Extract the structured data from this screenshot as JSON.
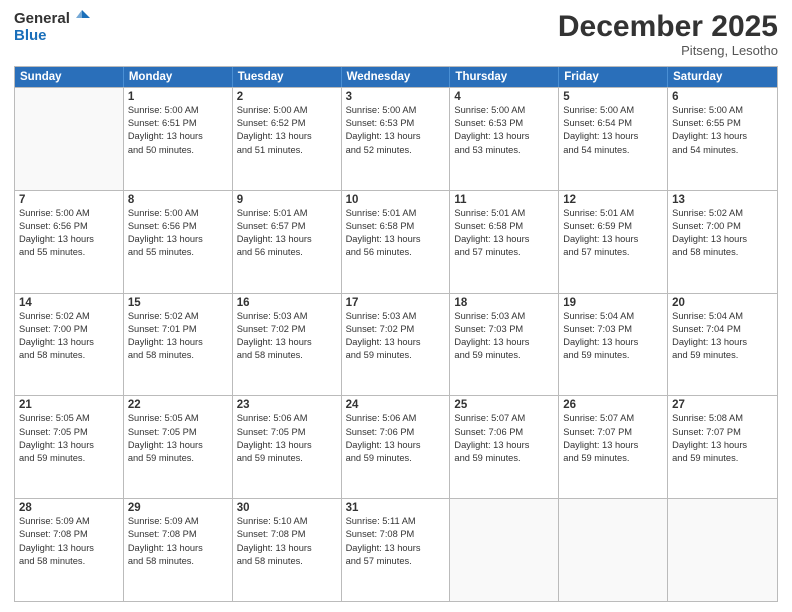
{
  "header": {
    "logo_general": "General",
    "logo_blue": "Blue",
    "month_title": "December 2025",
    "subtitle": "Pitseng, Lesotho"
  },
  "days_of_week": [
    "Sunday",
    "Monday",
    "Tuesday",
    "Wednesday",
    "Thursday",
    "Friday",
    "Saturday"
  ],
  "weeks": [
    [
      {
        "day": "",
        "empty": true
      },
      {
        "day": "1",
        "sunrise": "5:00 AM",
        "sunset": "6:51 PM",
        "daylight": "13 hours and 50 minutes."
      },
      {
        "day": "2",
        "sunrise": "5:00 AM",
        "sunset": "6:52 PM",
        "daylight": "13 hours and 51 minutes."
      },
      {
        "day": "3",
        "sunrise": "5:00 AM",
        "sunset": "6:53 PM",
        "daylight": "13 hours and 52 minutes."
      },
      {
        "day": "4",
        "sunrise": "5:00 AM",
        "sunset": "6:53 PM",
        "daylight": "13 hours and 53 minutes."
      },
      {
        "day": "5",
        "sunrise": "5:00 AM",
        "sunset": "6:54 PM",
        "daylight": "13 hours and 54 minutes."
      },
      {
        "day": "6",
        "sunrise": "5:00 AM",
        "sunset": "6:55 PM",
        "daylight": "13 hours and 54 minutes."
      }
    ],
    [
      {
        "day": "7",
        "sunrise": "5:00 AM",
        "sunset": "6:56 PM",
        "daylight": "13 hours and 55 minutes."
      },
      {
        "day": "8",
        "sunrise": "5:00 AM",
        "sunset": "6:56 PM",
        "daylight": "13 hours and 55 minutes."
      },
      {
        "day": "9",
        "sunrise": "5:01 AM",
        "sunset": "6:57 PM",
        "daylight": "13 hours and 56 minutes."
      },
      {
        "day": "10",
        "sunrise": "5:01 AM",
        "sunset": "6:58 PM",
        "daylight": "13 hours and 56 minutes."
      },
      {
        "day": "11",
        "sunrise": "5:01 AM",
        "sunset": "6:58 PM",
        "daylight": "13 hours and 57 minutes."
      },
      {
        "day": "12",
        "sunrise": "5:01 AM",
        "sunset": "6:59 PM",
        "daylight": "13 hours and 57 minutes."
      },
      {
        "day": "13",
        "sunrise": "5:02 AM",
        "sunset": "7:00 PM",
        "daylight": "13 hours and 58 minutes."
      }
    ],
    [
      {
        "day": "14",
        "sunrise": "5:02 AM",
        "sunset": "7:00 PM",
        "daylight": "13 hours and 58 minutes."
      },
      {
        "day": "15",
        "sunrise": "5:02 AM",
        "sunset": "7:01 PM",
        "daylight": "13 hours and 58 minutes."
      },
      {
        "day": "16",
        "sunrise": "5:03 AM",
        "sunset": "7:02 PM",
        "daylight": "13 hours and 58 minutes."
      },
      {
        "day": "17",
        "sunrise": "5:03 AM",
        "sunset": "7:02 PM",
        "daylight": "13 hours and 59 minutes."
      },
      {
        "day": "18",
        "sunrise": "5:03 AM",
        "sunset": "7:03 PM",
        "daylight": "13 hours and 59 minutes."
      },
      {
        "day": "19",
        "sunrise": "5:04 AM",
        "sunset": "7:03 PM",
        "daylight": "13 hours and 59 minutes."
      },
      {
        "day": "20",
        "sunrise": "5:04 AM",
        "sunset": "7:04 PM",
        "daylight": "13 hours and 59 minutes."
      }
    ],
    [
      {
        "day": "21",
        "sunrise": "5:05 AM",
        "sunset": "7:05 PM",
        "daylight": "13 hours and 59 minutes."
      },
      {
        "day": "22",
        "sunrise": "5:05 AM",
        "sunset": "7:05 PM",
        "daylight": "13 hours and 59 minutes."
      },
      {
        "day": "23",
        "sunrise": "5:06 AM",
        "sunset": "7:05 PM",
        "daylight": "13 hours and 59 minutes."
      },
      {
        "day": "24",
        "sunrise": "5:06 AM",
        "sunset": "7:06 PM",
        "daylight": "13 hours and 59 minutes."
      },
      {
        "day": "25",
        "sunrise": "5:07 AM",
        "sunset": "7:06 PM",
        "daylight": "13 hours and 59 minutes."
      },
      {
        "day": "26",
        "sunrise": "5:07 AM",
        "sunset": "7:07 PM",
        "daylight": "13 hours and 59 minutes."
      },
      {
        "day": "27",
        "sunrise": "5:08 AM",
        "sunset": "7:07 PM",
        "daylight": "13 hours and 59 minutes."
      }
    ],
    [
      {
        "day": "28",
        "sunrise": "5:09 AM",
        "sunset": "7:08 PM",
        "daylight": "13 hours and 58 minutes."
      },
      {
        "day": "29",
        "sunrise": "5:09 AM",
        "sunset": "7:08 PM",
        "daylight": "13 hours and 58 minutes."
      },
      {
        "day": "30",
        "sunrise": "5:10 AM",
        "sunset": "7:08 PM",
        "daylight": "13 hours and 58 minutes."
      },
      {
        "day": "31",
        "sunrise": "5:11 AM",
        "sunset": "7:08 PM",
        "daylight": "13 hours and 57 minutes."
      },
      {
        "day": "",
        "empty": true
      },
      {
        "day": "",
        "empty": true
      },
      {
        "day": "",
        "empty": true
      }
    ]
  ],
  "labels": {
    "sunrise": "Sunrise:",
    "sunset": "Sunset:",
    "daylight": "Daylight:"
  }
}
